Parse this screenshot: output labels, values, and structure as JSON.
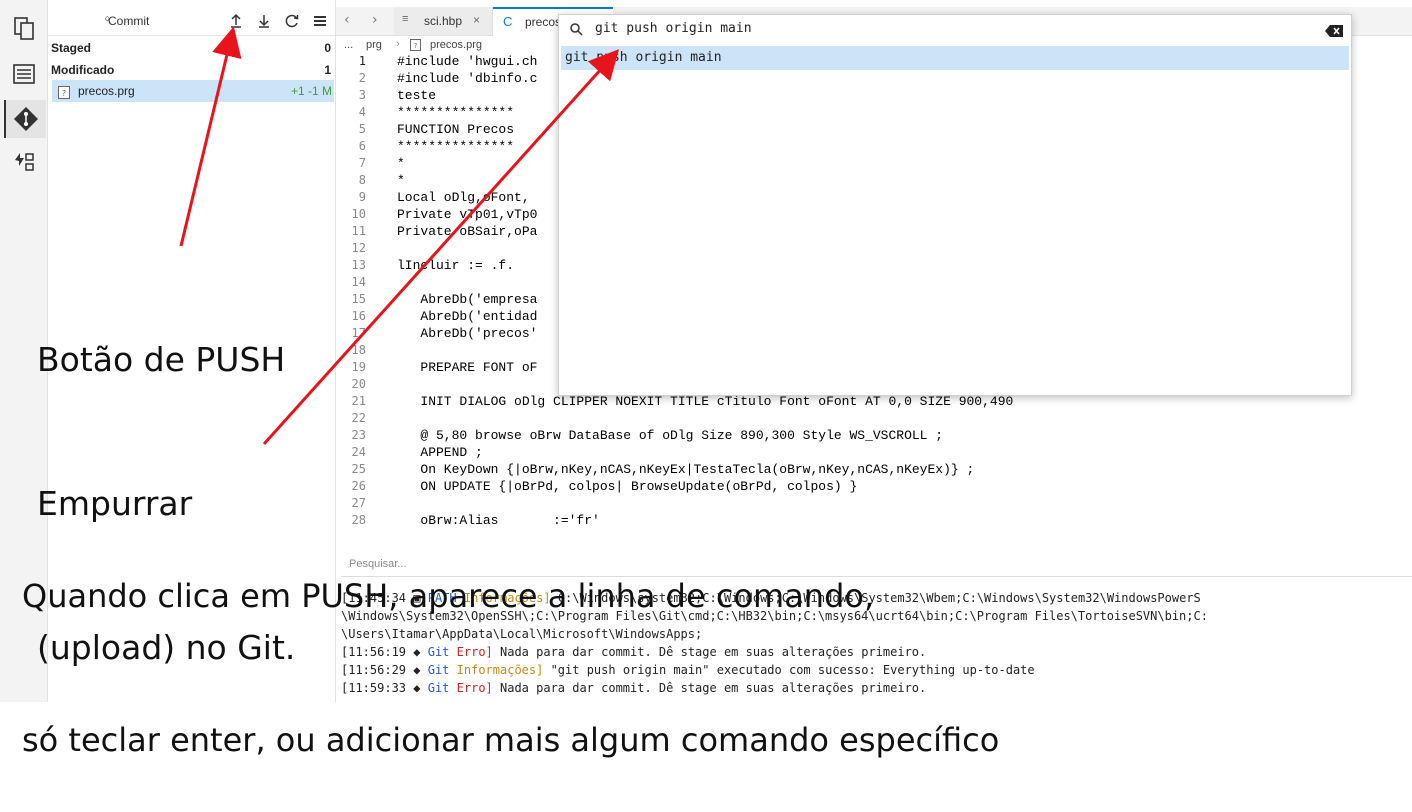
{
  "git_panel": {
    "title": "Commit",
    "staged_label": "Staged",
    "staged_count": "0",
    "modified_label": "Modificado",
    "modified_count": "1",
    "file_name": "precos.prg",
    "file_stat": "+1 -1 M"
  },
  "tabs": [
    {
      "label": "sci.hbp"
    },
    {
      "label": "precos"
    }
  ],
  "breadcrumb": {
    "dots": "...",
    "dir": "prg",
    "file": "precos.prg"
  },
  "editor": {
    "lines": [
      {
        "n": "1",
        "text": "#include 'hwgui.ch"
      },
      {
        "n": "2",
        "text": "#include 'dbinfo.c"
      },
      {
        "n": "3",
        "text": "teste"
      },
      {
        "n": "4",
        "text": "***************"
      },
      {
        "n": "5",
        "text": "FUNCTION Precos"
      },
      {
        "n": "6",
        "text": "***************"
      },
      {
        "n": "7",
        "text": "*"
      },
      {
        "n": "8",
        "text": "*"
      },
      {
        "n": "9",
        "text": "Local oDlg,oFont,"
      },
      {
        "n": "10",
        "text": "Private vTp01,vTp0"
      },
      {
        "n": "11",
        "text": "Private oBSair,oPa"
      },
      {
        "n": "12",
        "text": ""
      },
      {
        "n": "13",
        "text": "lIncluir := .f."
      },
      {
        "n": "14",
        "text": ""
      },
      {
        "n": "15",
        "text": "   AbreDb('empresa"
      },
      {
        "n": "16",
        "text": "   AbreDb('entidad"
      },
      {
        "n": "17",
        "text": "   AbreDb('precos'"
      },
      {
        "n": "18",
        "text": ""
      },
      {
        "n": "19",
        "text": "   PREPARE FONT oF"
      },
      {
        "n": "20",
        "text": ""
      },
      {
        "n": "21",
        "text": "   INIT DIALOG oDlg CLIPPER NOEXIT TITLE cTitulo Font oFont AT 0,0 SIZE 900,490"
      },
      {
        "n": "22",
        "text": ""
      },
      {
        "n": "23",
        "text": "   @ 5,80 browse oBrw DataBase of oDlg Size 890,300 Style WS_VSCROLL ;"
      },
      {
        "n": "24",
        "text": "   APPEND ;"
      },
      {
        "n": "25",
        "text": "   On KeyDown {|oBrw,nKey,nCAS,nKeyEx|TestaTecla(oBrw,nKey,nCAS,nKeyEx)} ;"
      },
      {
        "n": "26",
        "text": "   ON UPDATE {|oBrPd, colpos| BrowseUpdate(oBrPd, colpos) }"
      },
      {
        "n": "27",
        "text": ""
      },
      {
        "n": "28",
        "text": "   oBrw:Alias       :='fr'"
      }
    ]
  },
  "palette": {
    "input_value": "git push origin main",
    "result": "git push origin main"
  },
  "search": {
    "placeholder": "Pesquisar..."
  },
  "output": [
    {
      "time": "[11:45:34",
      "source": "PATH",
      "level": "Informações]",
      "msg": " C:\\Windows\\system32;C:\\Windows;C:\\Windows\\System32\\Wbem;C:\\Windows\\System32\\WindowsPowerS"
    },
    {
      "cont": "\\Windows\\System32\\OpenSSH\\;C:\\Program Files\\Git\\cmd;C:\\HB32\\bin;C:\\msys64\\ucrt64\\bin;C:\\Program Files\\TortoiseSVN\\bin;C:"
    },
    {
      "cont": "\\Users\\Itamar\\AppData\\Local\\Microsoft\\WindowsApps;"
    },
    {
      "time": "[11:56:19",
      "source": "Git",
      "level": "Erro]",
      "msg": " Nada para dar commit. Dê stage em suas alterações primeiro."
    },
    {
      "time": "[11:56:29",
      "source": "Git",
      "level": "Informações]",
      "msg": " \"git push origin main\" executado com sucesso: Everything up-to-date"
    },
    {
      "time": "[11:59:33",
      "source": "Git",
      "level": "Erro]",
      "msg": " Nada para dar commit. Dê stage em suas alterações primeiro."
    }
  ],
  "annotations": {
    "push_label_line1": "Botão de PUSH",
    "push_label_line2": "Empurrar",
    "push_label_line3": "(upload) no Git.",
    "bottom_line1": "Quando clica em PUSH, aparece a linha de comando,",
    "bottom_line2": "só teclar enter, ou adicionar mais algum comando específico"
  },
  "colors": {
    "arrow": "#e8141c",
    "selection": "#cce4f7",
    "accent": "#0a76d6"
  }
}
